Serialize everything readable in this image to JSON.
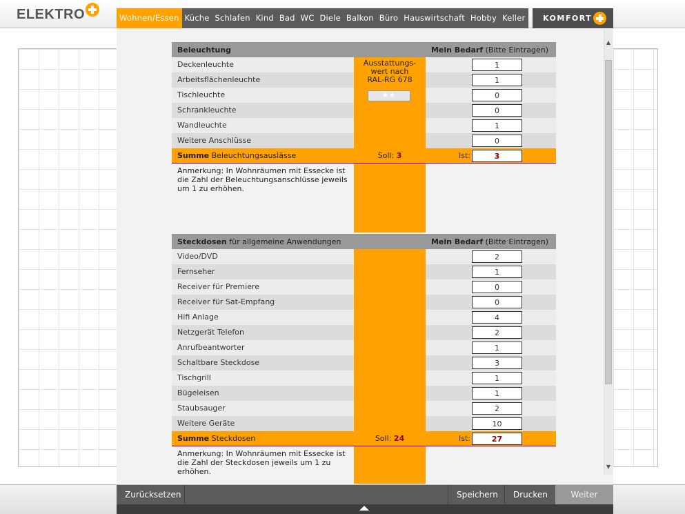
{
  "brand": {
    "name": "ELEKTRO"
  },
  "tabs": [
    "Wohnen/Essen",
    "Küche",
    "Schlafen",
    "Kind",
    "Bad",
    "WC",
    "Diele",
    "Balkon",
    "Büro",
    "Hauswirtschaft",
    "Hobby",
    "Keller"
  ],
  "active_tab": "Wohnen/Essen",
  "komfort": {
    "label": "KOMFORT"
  },
  "colors": {
    "accent": "#ffa200",
    "dark_bar": "#5b5b5b",
    "sum_value": "#8a0000"
  },
  "lighting": {
    "header_left_bold": "Beleuchtung",
    "header_right_bold": "Mein Bedarf",
    "header_right_note": "(Bitte Eintragen)",
    "rating_label": "Ausstattungs-\nwert nach\nRAL-RG 678",
    "rating_stars": "★★",
    "items": [
      {
        "label": "Deckenleuchte",
        "value": "1"
      },
      {
        "label": "Arbeitsflächenleuchte",
        "value": "1"
      },
      {
        "label": "Tischleuchte",
        "value": "0"
      },
      {
        "label": "Schrankleuchte",
        "value": "0"
      },
      {
        "label": "Wandleuchte",
        "value": "1"
      },
      {
        "label": "Weitere Anschlüsse",
        "value": "0"
      }
    ],
    "sum_bold": "Summe",
    "sum_label": "Beleuchtungsauslässe",
    "soll_label": "Soll:",
    "soll_value": "3",
    "ist_label": "Ist:",
    "ist_value": "3",
    "note": "Anmerkung: In Wohnräumen mit Essecke ist die Zahl der Beleuchtungsanschlüsse jeweils um 1 zu erhöhen."
  },
  "sockets": {
    "header_left_bold": "Steckdosen",
    "header_left_note": "für allgemeine Anwendungen",
    "header_right_bold": "Mein Bedarf",
    "header_right_note": "(Bitte Eintragen)",
    "items": [
      {
        "label": "Video/DVD",
        "value": "2"
      },
      {
        "label": "Fernseher",
        "value": "1"
      },
      {
        "label": "Receiver für Premiere",
        "value": "0"
      },
      {
        "label": "Receiver für Sat-Empfang",
        "value": "0"
      },
      {
        "label": "Hifi Anlage",
        "value": "4"
      },
      {
        "label": "Netzgerät Telefon",
        "value": "2"
      },
      {
        "label": "Anrufbeantworter",
        "value": "1"
      },
      {
        "label": "Schaltbare Steckdose",
        "value": "3"
      },
      {
        "label": "Tischgrill",
        "value": "1"
      },
      {
        "label": "Bügeleisen",
        "value": "1"
      },
      {
        "label": "Staubsauger",
        "value": "2"
      },
      {
        "label": "Weitere Geräte",
        "value": "10"
      }
    ],
    "sum_bold": "Summe",
    "sum_label": "Steckdosen",
    "soll_label": "Soll:",
    "soll_value": "24",
    "ist_label": "Ist:",
    "ist_value": "27",
    "note": "Anmerkung: In Wohnräumen mit Essecke ist die Zahl der Steckdosen jeweils um 1 zu erhöhen."
  },
  "footer": {
    "reset": "Zurücksetzen",
    "save": "Speichern",
    "print": "Drucken",
    "next": "Weiter"
  }
}
